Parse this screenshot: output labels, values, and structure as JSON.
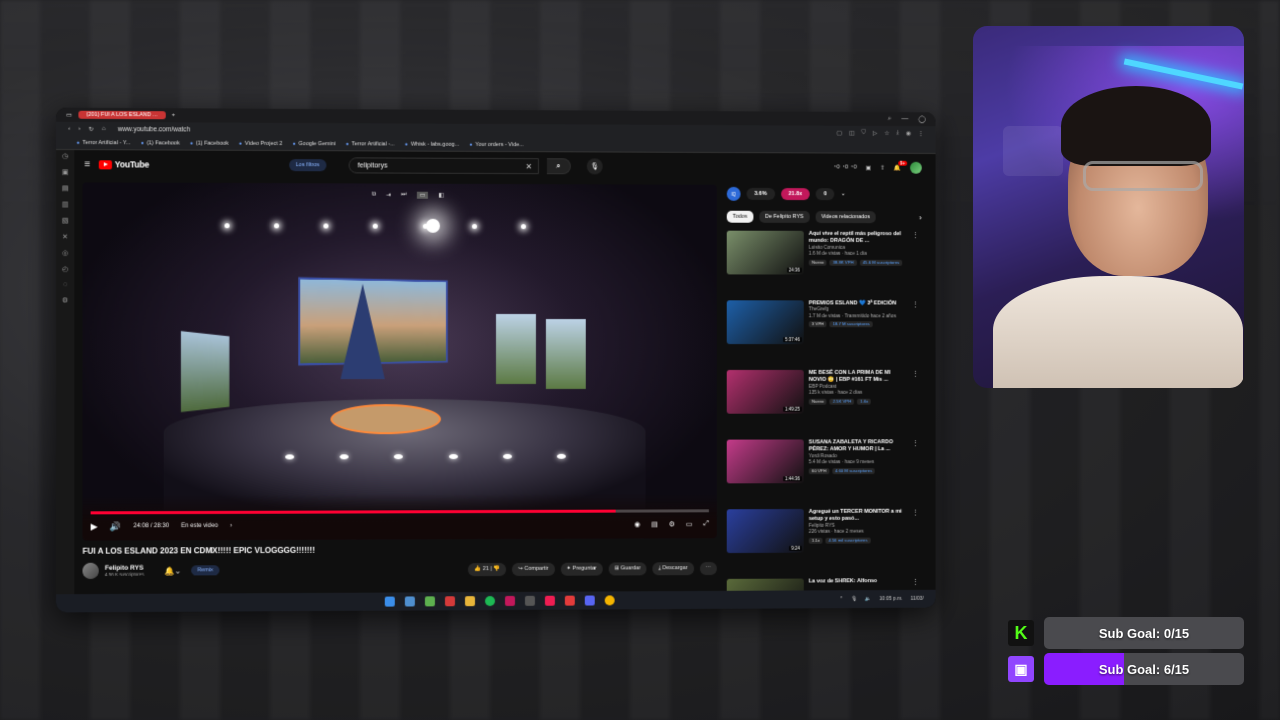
{
  "browser": {
    "tab_title": "(201) FUI A LOS ESLAND ...",
    "url": "www.youtube.com/watch",
    "bookmarks": [
      "Terror Artificial - Y...",
      "(1) Facebook",
      "(1) Facebook",
      "Video Project 2",
      "Google Gemini",
      "Terror Artificial -...",
      "Whisk - labs.goog...",
      "Your orders - Vide..."
    ]
  },
  "youtube": {
    "logo_text": "YouTube",
    "filters_label": "Los filtros",
    "search_value": "felipitorys",
    "notif_count": "9+",
    "player": {
      "time": "24:08 / 28:30",
      "chapter": "En este video",
      "progress": 0.847
    },
    "video_title": "FUI A LOS ESLAND 2023 EN CDMX!!!!! EPIC VLOGGGG!!!!!!!",
    "channel_name": "Felipito RYS",
    "channel_subs": "4.56 K suscriptores",
    "remix_label": "Remix",
    "actions": {
      "likes": "21",
      "share": "Compartir",
      "ask": "Preguntar",
      "save": "Guardar",
      "download": "Descargar"
    },
    "stats": {
      "logo": "IQ",
      "pct": "3.6%",
      "mult": "21.8x",
      "zero": "0"
    },
    "chips": [
      "Todos",
      "De Felipito RYS",
      "Videos relacionados"
    ],
    "recommendations": [
      {
        "title": "Aquí vive el reptil más peligroso del mundo: DRAGÓN DE ...",
        "channel": "Luisito Comunica",
        "meta": "1.6 M de vistas · hace 1 día",
        "duration": "24:36",
        "tag1": "Nuevo",
        "tag2": "38.8K VPH",
        "tag3": "45.6 M suscriptores",
        "color": "#7a8f6a"
      },
      {
        "title": "PREMIOS ESLAND 💙 3ª EDICIÓN",
        "channel": "TheGrefg",
        "meta": "1.7 M de vistas · Transmitido hace 2 años",
        "duration": "5:37:46",
        "tag1": "3 VPH",
        "tag2": "18.7 M suscriptores",
        "tag3": "",
        "color": "#1d5fa8"
      },
      {
        "title": "ME BESÉ CON LA PRIMA DE MI NOVIO 😳 | EBP #161 FT Mis ...",
        "channel": "EBP Podcast",
        "meta": "135 k vistas · hace 2 días",
        "duration": "1:49:25",
        "tag1": "Nuevo",
        "tag2": "2.5K VPH",
        "tag3": "1.6x",
        "color": "#b3306e"
      },
      {
        "title": "SUSANA ZABALETA Y RICARDO PÉREZ: AMOR Y HUMOR | La ...",
        "channel": "Yordi Rosado",
        "meta": "5.4 M de vistas · hace 9 meses",
        "duration": "1:44:36",
        "tag1": "60 VPH",
        "tag2": "4.60 M suscriptores",
        "tag3": "",
        "color": "#c43b8a"
      },
      {
        "title": "Agregué un TERCER MONITOR a mi setup y esto pasó...",
        "channel": "Felipito RYS",
        "meta": "226 vistas · hace 2 meses",
        "duration": "9:24",
        "tag1": "1.1x",
        "tag2": "4.56 mil suscriptores",
        "tag3": "",
        "color": "#2a3f9e"
      },
      {
        "title": "La voz de SHREK: Alfonso",
        "channel": "",
        "meta": "",
        "duration": "",
        "tag1": "",
        "tag2": "",
        "tag3": "",
        "color": "#5a6a3a"
      }
    ]
  },
  "clock": {
    "time": "10:05 p.m.",
    "date": "11/03/"
  },
  "overlay": {
    "kick_goal": {
      "label": "Sub Goal:",
      "value": "0/15",
      "progress": 0.0
    },
    "twitch_goal": {
      "label": "Sub Goal:",
      "value": "6/15",
      "progress": 0.4
    },
    "colors": {
      "kick": "#53fc18",
      "twitch": "#9146ff",
      "fill": "#8a1dff"
    }
  }
}
